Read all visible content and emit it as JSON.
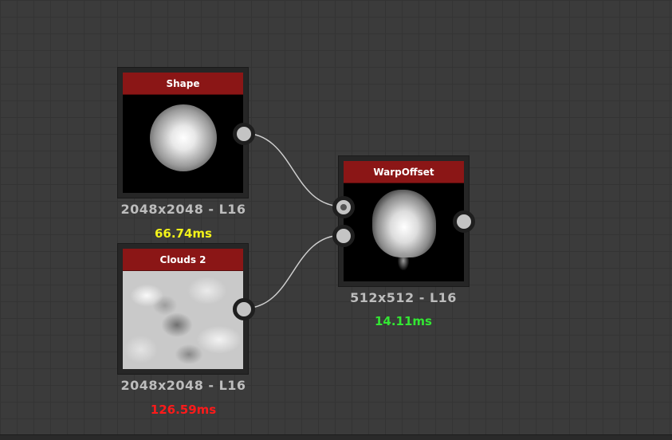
{
  "nodes": {
    "shape": {
      "title": "Shape",
      "resolution": "2048x2048 - L16",
      "time": "66.74ms",
      "time_color": "#f2f21a"
    },
    "clouds": {
      "title": "Clouds 2",
      "resolution": "2048x2048 - L16",
      "time": "126.59ms",
      "time_color": "#ff1a1a"
    },
    "warp": {
      "title": "WarpOffset",
      "resolution": "512x512 - L16",
      "time": "14.11ms",
      "time_color": "#33e633"
    }
  },
  "colors": {
    "header": "#8b1616",
    "background": "#3b3b3b",
    "wire": "#cfcfcf"
  }
}
